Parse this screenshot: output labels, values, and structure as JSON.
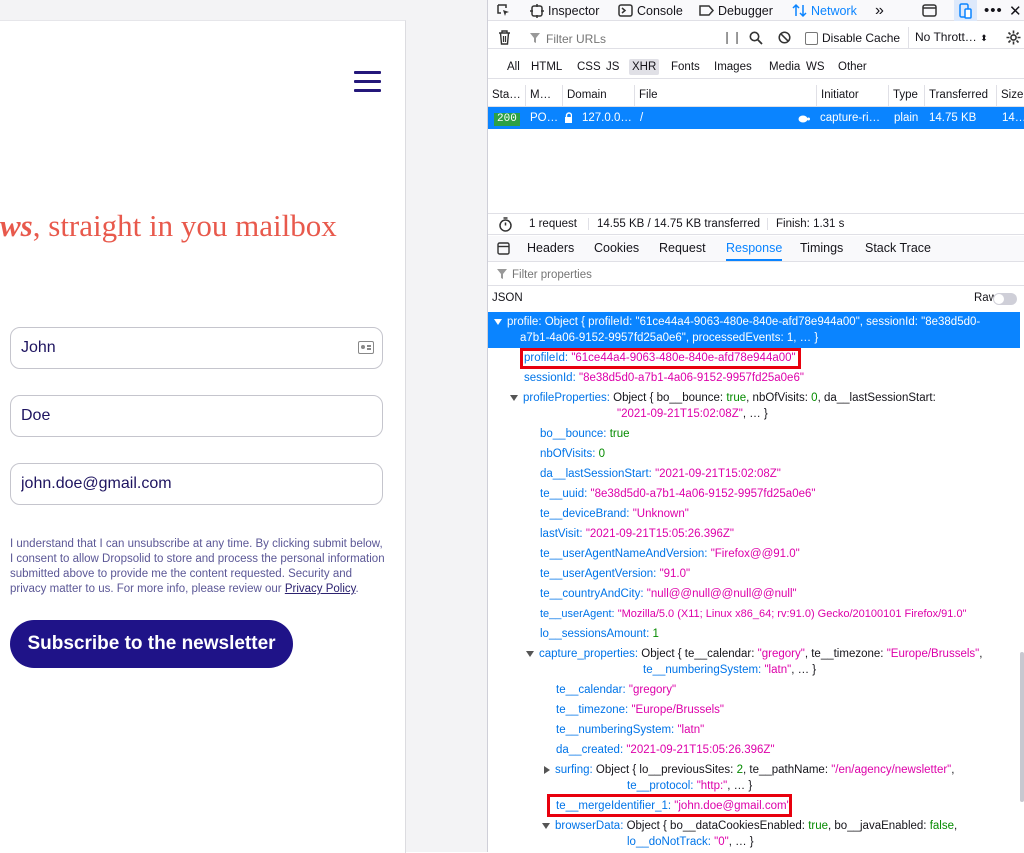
{
  "page": {
    "headline_bold": "ws",
    "headline_rest": ", straight in you mailbox",
    "form": {
      "first_name": "John",
      "last_name": "Doe",
      "email": "john.doe@gmail.com"
    },
    "consent_text": "I understand that I can unsubscribe at any time. By clicking submit below, I consent to allow Dropsolid to store and process the personal information submitted above to provide me the content requested. Security and privacy matter to us. For more info, please review our ",
    "consent_link": "Privacy Policy",
    "consent_end": ".",
    "subscribe_label": "Subscribe to the newsletter"
  },
  "devtools": {
    "tabs": {
      "inspector": "Inspector",
      "console": "Console",
      "debugger": "Debugger",
      "network": "Network"
    },
    "filter_placeholder": "Filter URLs",
    "disable_cache": "Disable Cache",
    "throttle": "No Thrott…",
    "type_filters": [
      "All",
      "HTML",
      "CSS",
      "JS",
      "XHR",
      "Fonts",
      "Images",
      "Media",
      "WS",
      "Other"
    ],
    "columns": {
      "status": "Sta…",
      "method": "M…",
      "domain": "Domain",
      "file": "File",
      "initiator": "Initiator",
      "type": "Type",
      "transferred": "Transferred",
      "size": "Size"
    },
    "request": {
      "status": "200",
      "method": "PO…",
      "domain": "127.0.0…",
      "file": "/",
      "initiator": "capture-ri…",
      "type": "plain",
      "transferred": "14.75 KB",
      "size": "14…"
    },
    "summary": {
      "requests": "1 request",
      "transferred": "14.55 KB / 14.75 KB transferred",
      "finish": "Finish: 1.31 s"
    },
    "pane_tabs": [
      "Headers",
      "Cookies",
      "Request",
      "Response",
      "Timings",
      "Stack Trace"
    ],
    "props_filter_placeholder": "Filter properties",
    "json_label": "JSON",
    "raw_label": "Raw",
    "tree": {
      "profile_line1": "profile: Object { profileId: \"61ce44a4-9063-480e-840e-afd78e944a00\", sessionId: \"8e38d5d0-",
      "profile_line2": "a7b1-4a06-9152-9957fd25a0e6\", processedEvents: 1, … }",
      "profileId_key": "profileId:",
      "profileId_val": "\"61ce44a4-9063-480e-840e-afd78e944a00\"",
      "sessionId_key": "sessionId:",
      "sessionId_val": "\"8e38d5d0-a7b1-4a06-9152-9957fd25a0e6\"",
      "pp_key": "profileProperties:",
      "pp_l1a": "Object { bo__bounce:",
      "pp_l1b": "true",
      "pp_l1c": ", nbOfVisits:",
      "pp_l1d": "0",
      "pp_l1e": ", da__lastSessionStart:",
      "pp_l2a": "\"2021-09-21T15:02:08Z\"",
      "pp_l2b": ", … }",
      "bounce_key": "bo__bounce:",
      "bounce_val": "true",
      "visits_key": "nbOfVisits:",
      "visits_val": "0",
      "lastsess_key": "da__lastSessionStart:",
      "lastsess_val": "\"2021-09-21T15:02:08Z\"",
      "uuid_key": "te__uuid:",
      "uuid_val": "\"8e38d5d0-a7b1-4a06-9152-9957fd25a0e6\"",
      "brand_key": "te__deviceBrand:",
      "brand_val": "\"Unknown\"",
      "lastvisit_key": "lastVisit:",
      "lastvisit_val": "\"2021-09-21T15:05:26.396Z\"",
      "uanv_key": "te__userAgentNameAndVersion:",
      "uanv_val": "\"Firefox@@91.0\"",
      "uav_key": "te__userAgentVersion:",
      "uav_val": "\"91.0\"",
      "city_key": "te__countryAndCity:",
      "city_val": "\"null@@null@@null@@null\"",
      "ua_key": "te__userAgent:",
      "ua_val": "\"Mozilla/5.0 (X11; Linux x86_64; rv:91.0) Gecko/20100101 Firefox/91.0\"",
      "sessamt_key": "lo__sessionsAmount:",
      "sessamt_val": "1",
      "cp_key": "capture_properties:",
      "cp_l1a": "Object { te__calendar:",
      "cp_l1b": "\"gregory\"",
      "cp_l1c": ", te__timezone:",
      "cp_l1d": "\"Europe/Brussels\"",
      "cp_l1e": ",",
      "cp_l2a": "te__numberingSystem:",
      "cp_l2b": "\"latn\"",
      "cp_l2c": ", … }",
      "cal_key": "te__calendar:",
      "cal_val": "\"gregory\"",
      "tz_key": "te__timezone:",
      "tz_val": "\"Europe/Brussels\"",
      "num_key": "te__numberingSystem:",
      "num_val": "\"latn\"",
      "created_key": "da__created:",
      "created_val": "\"2021-09-21T15:05:26.396Z\"",
      "surf_key": "surfing:",
      "surf_l1a": "Object { lo__previousSites:",
      "surf_l1b": "2",
      "surf_l1c": ", te__pathName:",
      "surf_l1d": "\"/en/agency/newsletter\"",
      "surf_l1e": ",",
      "surf_l2a": "te__protocol:",
      "surf_l2b": "\"http:\"",
      "surf_l2c": ", … }",
      "merge_key": "te__mergeIdentifier_1:",
      "merge_val": "\"john.doe@gmail.com\"",
      "bd_key": "browserData:",
      "bd_l1a": "Object { bo__dataCookiesEnabled:",
      "bd_l1b": "true",
      "bd_l1c": ", bo__javaEnabled:",
      "bd_l1d": "false",
      "bd_l1e": ",",
      "bd_l2a": "lo__doNotTrack:",
      "bd_l2b": "\"0\"",
      "bd_l2c": ", … }"
    }
  },
  "colors": {
    "accent": "#0a84ff",
    "headline": "#e8594c",
    "button": "#1f1388",
    "highlight_box": "#e8000d"
  }
}
